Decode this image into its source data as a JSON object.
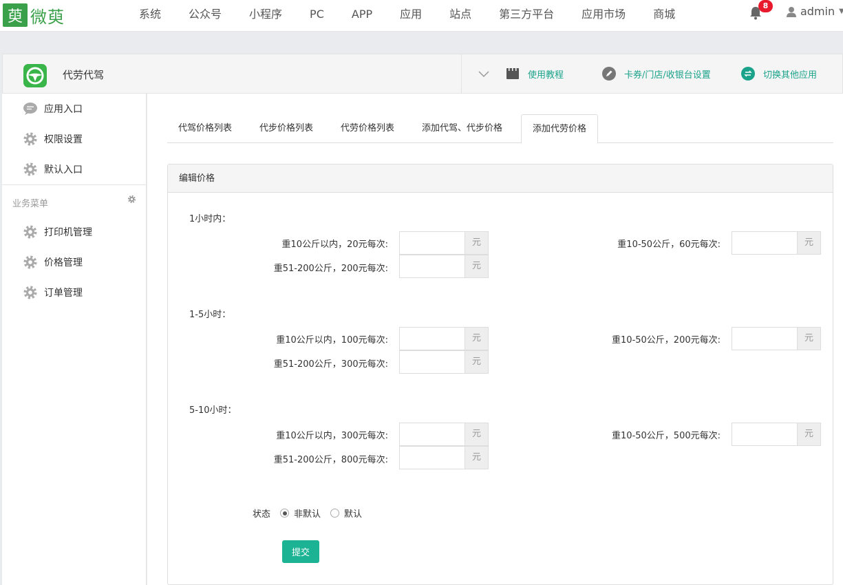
{
  "brand": {
    "logo_glyph": "萸",
    "name": "微萸",
    "color": "#3aa14a"
  },
  "topnav": {
    "items": [
      "系统",
      "公众号",
      "小程序",
      "PC",
      "APP",
      "应用",
      "站点",
      "第三方平台",
      "应用市场",
      "商城"
    ],
    "notification_count": "8",
    "user": "admin"
  },
  "app": {
    "name": "代劳代驾",
    "links": {
      "tutorial": "使用教程",
      "settings": "卡券/门店/收银台设置",
      "switch": "切换其他应用"
    },
    "accent": "#1aa38a"
  },
  "sidebar": {
    "top_items": [
      "应用入口",
      "权限设置",
      "默认入口"
    ],
    "section_title": "业务菜单",
    "biz_items": [
      "打印机管理",
      "价格管理",
      "订单管理"
    ]
  },
  "tabs": [
    "代驾价格列表",
    "代步价格列表",
    "代劳价格列表",
    "添加代驾、代步价格",
    "添加代劳价格"
  ],
  "active_tab": 4,
  "panel": {
    "title": "编辑价格",
    "unit": "元",
    "groups": [
      {
        "title": "1小时内：",
        "fields": [
          {
            "label": "重10公斤以内，20元每次:",
            "value": ""
          },
          {
            "label": "重10-50公斤，60元每次:",
            "value": ""
          },
          {
            "label": "重51-200公斤，200元每次:",
            "value": ""
          }
        ]
      },
      {
        "title": "1-5小时：",
        "fields": [
          {
            "label": "重10公斤以内，100元每次:",
            "value": ""
          },
          {
            "label": "重10-50公斤，200元每次:",
            "value": ""
          },
          {
            "label": "重51-200公斤，300元每次:",
            "value": ""
          }
        ]
      },
      {
        "title": "5-10小时：",
        "fields": [
          {
            "label": "重10公斤以内，300元每次:",
            "value": ""
          },
          {
            "label": "重10-50公斤，500元每次:",
            "value": ""
          },
          {
            "label": "重51-200公斤，800元每次:",
            "value": ""
          }
        ]
      }
    ],
    "status": {
      "label": "状态",
      "options": [
        "非默认",
        "默认"
      ],
      "selected": "非默认"
    },
    "submit": "提交",
    "submit_color": "#1bb394"
  }
}
